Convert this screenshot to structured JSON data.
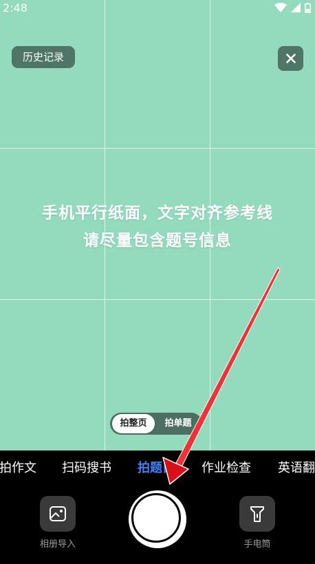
{
  "status_bar": {
    "time": "2:48",
    "icons": [
      "wifi-icon",
      "signal-icon",
      "battery-icon"
    ]
  },
  "header": {
    "history_label": "历史记录",
    "close_icon": "close-icon"
  },
  "camera": {
    "hint_line1": "手机平行纸面，文字对齐参考线",
    "hint_line2": "请尽量包含题号信息",
    "mode_toggle": {
      "whole_page": "拍整页",
      "single_question": "拍单题",
      "selected": "拍整页"
    }
  },
  "tabs": {
    "items": [
      {
        "label": "拍作文"
      },
      {
        "label": "扫码搜书"
      },
      {
        "label": "拍题目",
        "active": true
      },
      {
        "label": "作业检查"
      },
      {
        "label": "英语翻译"
      }
    ]
  },
  "bottom_bar": {
    "album_label": "相册导入",
    "flashlight_label": "手电筒",
    "album_icon": "image-icon",
    "flashlight_icon": "flashlight-icon"
  },
  "colors": {
    "camera_bg": "#94dbbd",
    "chip_bg": "#4f7566",
    "active_tab": "#3c82f6",
    "arrow": "#e0141e"
  }
}
